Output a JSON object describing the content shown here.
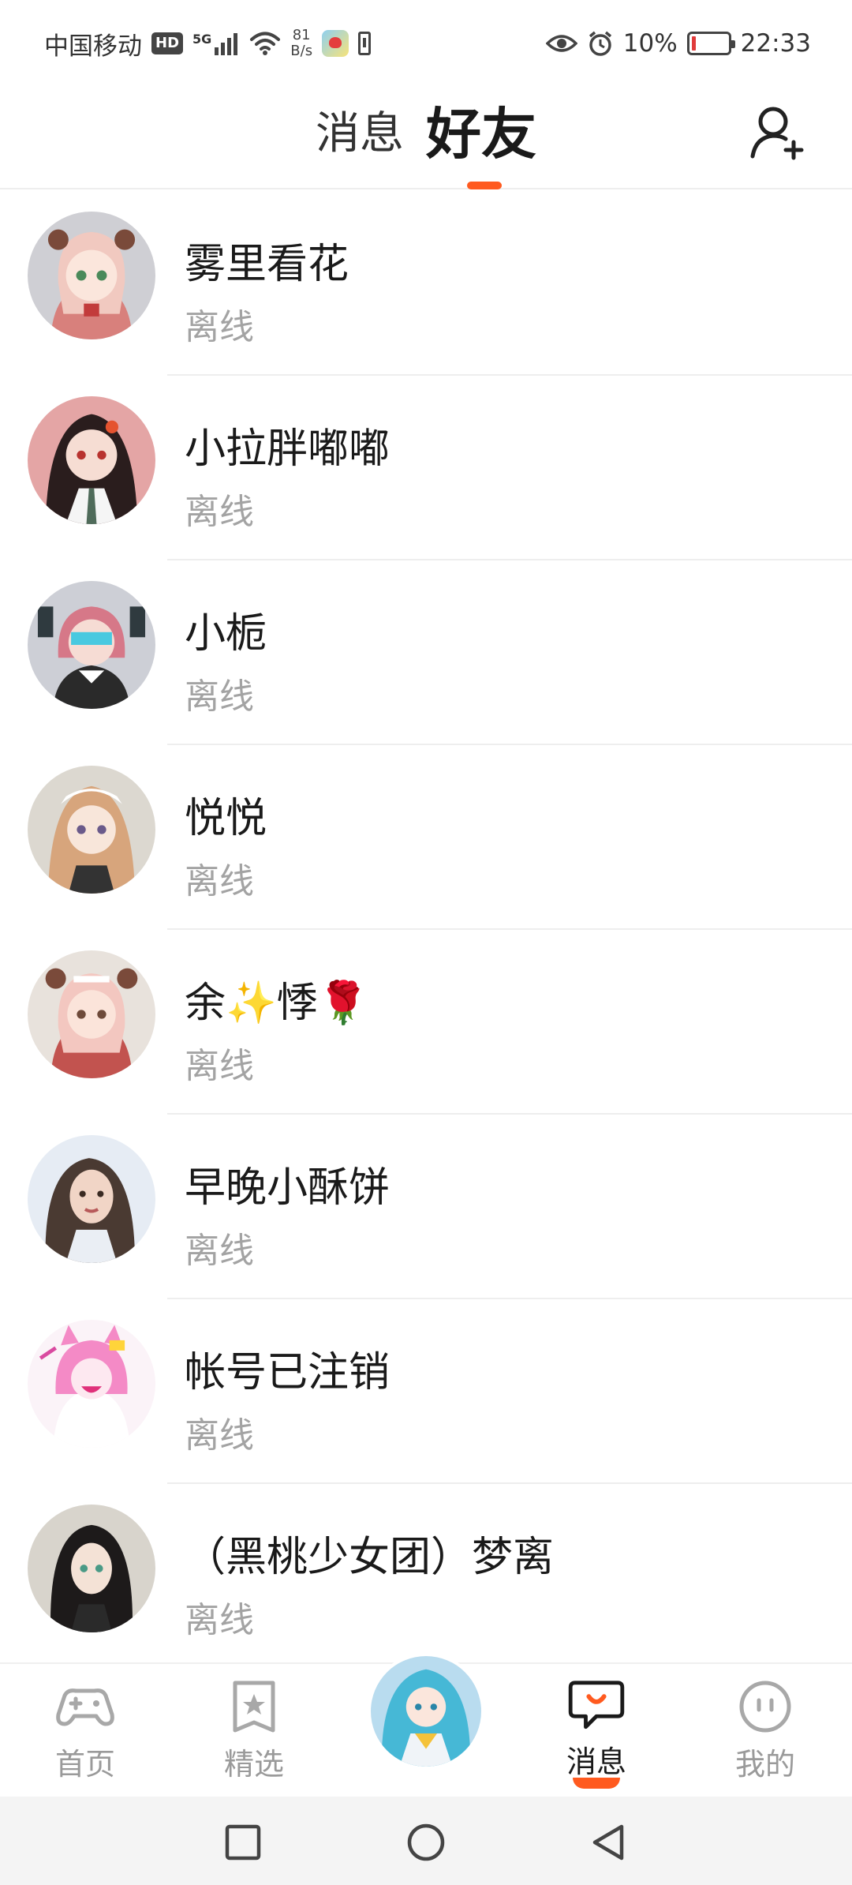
{
  "status_bar": {
    "carrier": "中国移动",
    "hd": "HD",
    "network": "5G",
    "speed_value": "81",
    "speed_unit": "B/s",
    "battery": "10%",
    "time": "22:33"
  },
  "header": {
    "tabs": [
      {
        "label": "消息",
        "active": false
      },
      {
        "label": "好友",
        "active": true
      }
    ],
    "accent_color": "#ff5a1f"
  },
  "friends": [
    {
      "name": "雾里看花",
      "status": "离线",
      "avatar": "avatar-1"
    },
    {
      "name": "小拉胖嘟嘟",
      "status": "离线",
      "avatar": "avatar-2"
    },
    {
      "name": "小栀",
      "status": "离线",
      "avatar": "avatar-3"
    },
    {
      "name": "悦悦",
      "status": "离线",
      "avatar": "avatar-4"
    },
    {
      "name": "余✨悸🌹",
      "status": "离线",
      "avatar": "avatar-5"
    },
    {
      "name": "早晚小酥饼",
      "status": "离线",
      "avatar": "avatar-6"
    },
    {
      "name": "帐号已注销",
      "status": "离线",
      "avatar": "avatar-7"
    },
    {
      "name": "（黑桃少女团）梦离",
      "status": "离线",
      "avatar": "avatar-8"
    }
  ],
  "bottom_nav": {
    "items": [
      {
        "label": "首页",
        "icon": "gamepad-icon",
        "active": false
      },
      {
        "label": "精选",
        "icon": "star-badge-icon",
        "active": false
      },
      {
        "label": "消息",
        "icon": "chat-bubble-icon",
        "active": true
      },
      {
        "label": "我的",
        "icon": "face-icon",
        "active": false
      }
    ]
  }
}
